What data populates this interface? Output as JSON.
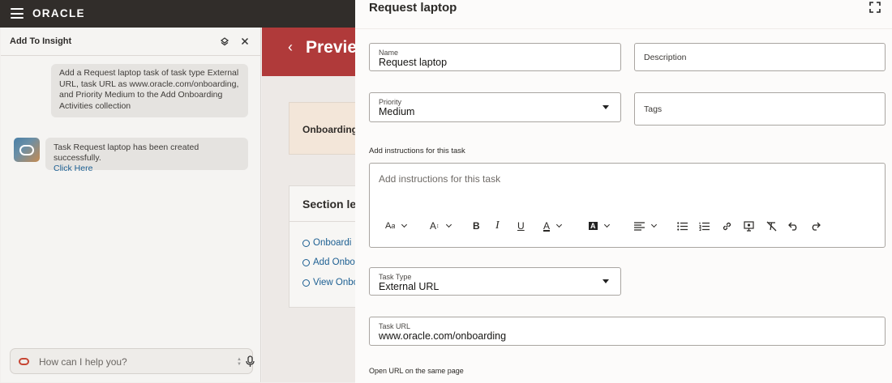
{
  "topbar": {
    "logo": "ORACLE"
  },
  "assistant": {
    "title": "Add To Insight",
    "user_message": "Add a Request laptop task of task type External URL, task URL as www.oracle.com/onboarding, and Priority Medium to the Add Onboarding Activities collection",
    "bot_message": "Task Request laptop has been created successfully.",
    "bot_link": "Click Here",
    "input_placeholder": "How can I help you?"
  },
  "background_page": {
    "title": "Previe",
    "card_title": "Onboarding",
    "section_title": "Section le",
    "links": [
      "Onboardi",
      "Add Onbo",
      "View Onbo"
    ]
  },
  "drawer": {
    "title": "Request laptop",
    "name": {
      "label": "Name",
      "value": "Request laptop"
    },
    "description": {
      "placeholder": "Description"
    },
    "priority": {
      "label": "Priority",
      "value": "Medium"
    },
    "tags": {
      "placeholder": "Tags"
    },
    "instructions_label": "Add instructions for this task",
    "instructions_placeholder": "Add instructions for this task",
    "task_type": {
      "label": "Task Type",
      "value": "External URL"
    },
    "task_url": {
      "label": "Task URL",
      "value": "www.oracle.com/onboarding"
    },
    "open_url_label": "Open URL on the same page"
  },
  "toolbar_icons": [
    "font-size-icon",
    "font-family-icon",
    "bold-icon",
    "italic-icon",
    "underline-icon",
    "text-color-icon",
    "highlight-icon",
    "align-icon",
    "bullet-list-icon",
    "numbered-list-icon",
    "link-icon",
    "image-icon",
    "clear-format-icon",
    "undo-icon",
    "redo-icon"
  ],
  "colors": {
    "topbar": "#312d2a",
    "link": "#1c5f92",
    "banner": "#b03a3a",
    "brand_red": "#c74634"
  }
}
